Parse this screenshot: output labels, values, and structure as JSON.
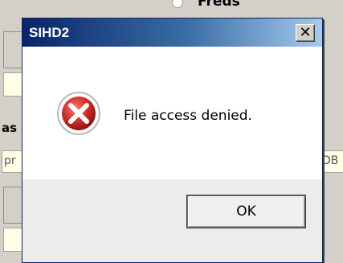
{
  "background": {
    "top_label": "Freds",
    "left_bold_label": "as",
    "left_field_text": "pr",
    "right_field_text": "DB"
  },
  "dialog": {
    "title": "SIHD2",
    "close_glyph": "✕",
    "message": "File access denied.",
    "icon": "error-icon",
    "ok_label": "OK"
  },
  "colors": {
    "title_start": "#0a246a",
    "title_end": "#a6caf0",
    "error_red": "#d4322a"
  }
}
